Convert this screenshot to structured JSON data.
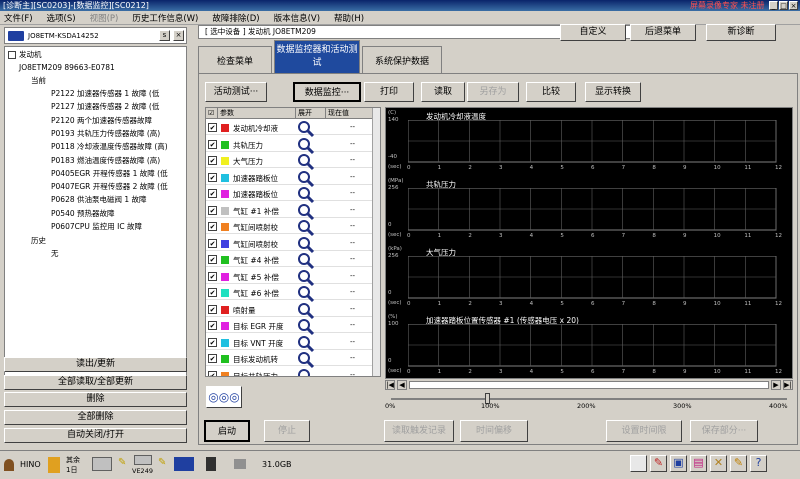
{
  "window": {
    "title": "[诊断主][SC0203]-[数据监控][SC0212]",
    "watermark": "屏幕录像专家 未注册"
  },
  "menu": [
    {
      "label": "文件(F)",
      "enabled": true
    },
    {
      "label": "选项(S)",
      "enabled": true
    },
    {
      "label": "视图(P)",
      "enabled": false
    },
    {
      "label": "历史工作信息(W)",
      "enabled": true
    },
    {
      "label": "故障排除(D)",
      "enabled": true
    },
    {
      "label": "版本信息(V)",
      "enabled": true
    },
    {
      "label": "帮助(H)",
      "enabled": true
    }
  ],
  "vehicle": {
    "id": "JO8ETM-KSDA14252",
    "btn": "s"
  },
  "tree": {
    "root": "发动机",
    "engine": "JO8ETM209 89663-E0781",
    "current": "当前",
    "history": "历史",
    "none": "无",
    "codes": [
      "P2122 加速器传感器 1 故障 (低",
      "P2127 加速器传感器 2 故障 (低",
      "P2120 两个加速器传感器故障",
      "P0193 共轨压力传感器故障 (高)",
      "P0118 冷却液温度传感器故障 (高)",
      "P0183 燃油温度传感器故障 (高)",
      "P0405EGR 开程传感器 1 故障 (低",
      "P0407EGR 开程传感器 2 故障 (低",
      "P0628 供油泵电磁阀 1 故障",
      "P0540 预热器故障",
      "P0607CPU 监控用 IC 故障"
    ]
  },
  "left_buttons": [
    "读出/更新",
    "全部读取/全部更新",
    "删除",
    "全部删除",
    "自动关闭/打开"
  ],
  "context": {
    "label": "[ 选中设备 ]  发动机  JO8ETM209"
  },
  "top_buttons": [
    "自定义",
    "后退菜单",
    "新诊断"
  ],
  "tabs": [
    "检查菜单",
    "数据监控器和活动测试",
    "系统保护数据"
  ],
  "toolbar": [
    "活动测试···",
    "数据监控···",
    "打印",
    "读取",
    "另存为",
    "比较",
    "显示转换"
  ],
  "param_header": {
    "param": "参数",
    "expand": "展开",
    "value": "现在值"
  },
  "params": [
    {
      "name": "发动机冷却液",
      "color": "#e02020",
      "value": "--"
    },
    {
      "name": "共轨压力",
      "color": "#20c020",
      "value": "--"
    },
    {
      "name": "大气压力",
      "color": "#f0f020",
      "value": "--"
    },
    {
      "name": "加速器踏板位",
      "color": "#20c0e0",
      "value": "--"
    },
    {
      "name": "加速器踏板位",
      "color": "#e020e0",
      "value": "--"
    },
    {
      "name": "气缸 #1 补偿",
      "color": "#c0c0c0",
      "value": "--"
    },
    {
      "name": "气缸间喷射校",
      "color": "#f08020",
      "value": "--"
    },
    {
      "name": "气缸间喷射校",
      "color": "#4040e0",
      "value": "--"
    },
    {
      "name": "气缸 #4 补偿",
      "color": "#20c020",
      "value": "--"
    },
    {
      "name": "气缸 #5 补偿",
      "color": "#e020e0",
      "value": "--"
    },
    {
      "name": "气缸 #6 补偿",
      "color": "#20e0c0",
      "value": "--"
    },
    {
      "name": "喷射量",
      "color": "#e02020",
      "value": "--"
    },
    {
      "name": "目标 EGR 开度",
      "color": "#e020e0",
      "value": "--"
    },
    {
      "name": "目标 VNT 开度",
      "color": "#20c0e0",
      "value": "--"
    },
    {
      "name": "目标发动机转",
      "color": "#20c020",
      "value": "--"
    },
    {
      "name": "目标共轨压力",
      "color": "#f08020",
      "value": "--"
    }
  ],
  "graphs": [
    {
      "title": "发动机冷却液温度",
      "unit": "(C)",
      "ymax": "140",
      "ymin": "-40"
    },
    {
      "title": "共轨压力",
      "unit": "(MPa)",
      "ymax": "256",
      "ymin": "0"
    },
    {
      "title": "大气压力",
      "unit": "(kPa)",
      "ymax": "256",
      "ymin": "0"
    },
    {
      "title": "加速器踏板位置传感器 #1 (传感器电压 x 20)",
      "unit": "(%)",
      "ymax": "100",
      "ymin": "0"
    }
  ],
  "x_ticks": [
    "0",
    "1",
    "2",
    "3",
    "4",
    "5",
    "6",
    "7",
    "8",
    "9",
    "10",
    "11",
    "12"
  ],
  "x_unit": "(sec)",
  "zoom_marks": [
    "0%",
    "100%",
    "200%",
    "300%",
    "400%"
  ],
  "bottom_buttons": [
    {
      "label": "启动",
      "enabled": true
    },
    {
      "label": "停止",
      "enabled": false
    },
    {
      "label": "读取触发记录",
      "enabled": false
    },
    {
      "label": "时间偏移",
      "enabled": false
    },
    {
      "label": "设置时间限",
      "enabled": false
    },
    {
      "label": "保存部分···",
      "enabled": false
    }
  ],
  "status": {
    "user": "HINO",
    "count_label": "其余",
    "count_value": "1日",
    "device": "VE249",
    "disk": "31.0GB"
  }
}
